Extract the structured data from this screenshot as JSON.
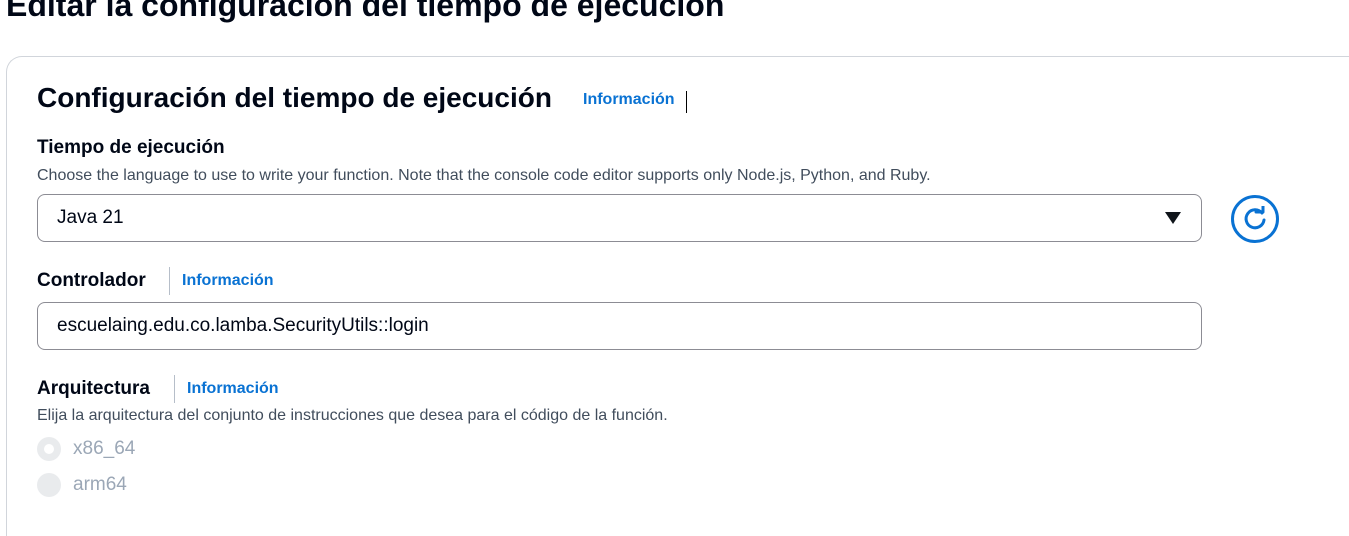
{
  "page": {
    "title": "Editar la configuración del tiempo de ejecución"
  },
  "section": {
    "title": "Configuración del tiempo de ejecución",
    "info_link": "Información"
  },
  "runtime": {
    "label": "Tiempo de ejecución",
    "description": "Choose the language to use to write your function. Note that the console code editor supports only Node.js, Python, and Ruby.",
    "selected": "Java 21",
    "refresh_icon": "refresh-icon"
  },
  "handler": {
    "label": "Controlador",
    "info_link": "Información",
    "value": "escuelaing.edu.co.lamba.SecurityUtils::login"
  },
  "architecture": {
    "label": "Arquitectura",
    "info_link": "Información",
    "description": "Elija la arquitectura del conjunto de instrucciones que desea para el código de la función.",
    "options": [
      {
        "label": "x86_64",
        "checked": true,
        "disabled": true
      },
      {
        "label": "arm64",
        "checked": false,
        "disabled": true
      }
    ]
  },
  "colors": {
    "link": "#0972d3",
    "text": "#000716",
    "disabled": "#9ba7b6"
  }
}
